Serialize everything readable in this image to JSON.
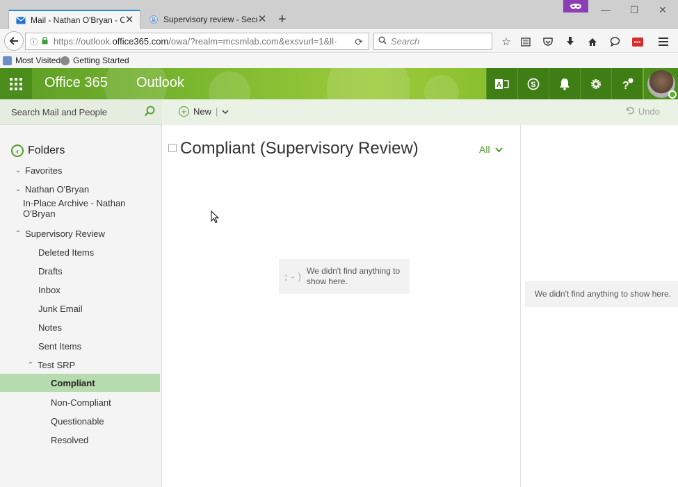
{
  "browser": {
    "tabs": [
      {
        "title": "Mail - Nathan O'Bryan - O...",
        "icon": "mail-icon",
        "active": true
      },
      {
        "title": "Supervisory review - Secur...",
        "icon": "lock-icon",
        "active": false
      }
    ],
    "url_prefix": "https://outlook.",
    "url_domain": "office365.com",
    "url_rest": "/owa/?realm=mcsmlab.com&exsvurl=1&ll-",
    "search_placeholder": "Search",
    "bookmarks": [
      "Most Visited",
      "Getting Started"
    ]
  },
  "o365": {
    "brand": "Office 365",
    "app_name": "Outlook"
  },
  "commandbar": {
    "search_placeholder": "Search Mail and People",
    "new_label": "New",
    "undo_label": "Undo"
  },
  "folders": {
    "header": "Folders",
    "items": [
      {
        "label": "Favorites",
        "chevron": "down"
      },
      {
        "label": "Nathan O'Bryan",
        "chevron": "down"
      },
      {
        "label": "In-Place Archive - Nathan O'Bryan",
        "chevron": ""
      },
      {
        "label": "Supervisory Review",
        "chevron": "up"
      },
      {
        "label": "Deleted Items",
        "chevron": ""
      },
      {
        "label": "Drafts",
        "chevron": ""
      },
      {
        "label": "Inbox",
        "chevron": ""
      },
      {
        "label": "Junk Email",
        "chevron": ""
      },
      {
        "label": "Notes",
        "chevron": ""
      },
      {
        "label": "Sent Items",
        "chevron": ""
      },
      {
        "label": "Test SRP",
        "chevron": "up"
      },
      {
        "label": "Compliant",
        "chevron": "",
        "selected": true
      },
      {
        "label": "Non-Compliant",
        "chevron": ""
      },
      {
        "label": "Questionable",
        "chevron": ""
      },
      {
        "label": "Resolved",
        "chevron": ""
      }
    ]
  },
  "list": {
    "title": "Compliant (Supervisory Review)",
    "filter_label": "All",
    "empty_face": ":-)",
    "empty_message": "We didn't find anything to show here."
  },
  "reading": {
    "empty_message": "We didn't find anything to show here."
  },
  "colors": {
    "accent": "#4e9b2a",
    "selected_folder": "#b5dbae",
    "header_green": "#7cb82f"
  }
}
